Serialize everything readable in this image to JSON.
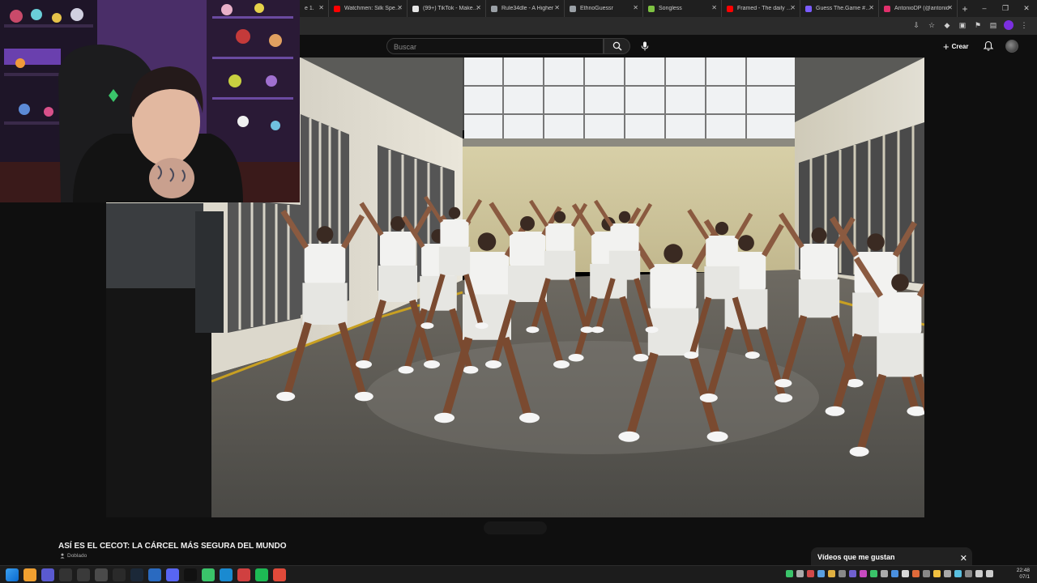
{
  "browser": {
    "tabs": [
      {
        "label": "e 1.",
        "color": "#c33"
      },
      {
        "label": "Watchmen: Silk Spectre",
        "color": "#ff0000"
      },
      {
        "label": "(99+) TikTok - Make Yo",
        "color": "#e5e5e5"
      },
      {
        "label": "Rule34dle - A Higher",
        "color": "#9aa0a6"
      },
      {
        "label": "EthnoGuessr",
        "color": "#9aa0a6"
      },
      {
        "label": "Songless",
        "color": "#7ec242"
      },
      {
        "label": "Framed - The daily mo",
        "color": "#ff0000"
      },
      {
        "label": "Guess The.Game #133",
        "color": "#7b5cff"
      },
      {
        "label": "AntonioDP (@antonio",
        "color": "#e1306c"
      }
    ],
    "window_controls": {
      "minimize": "–",
      "maximize": "❐",
      "close": "✕"
    }
  },
  "youtube": {
    "search_placeholder": "Buscar",
    "create_label": "Crear",
    "video_title": "ASÍ ES EL CECOT: LA CÁRCEL MÁS SEGURA DEL MUNDO",
    "dub_label": "Doblado",
    "liked_panel_title": "Vídeos que me gustan"
  },
  "taskbar": {
    "time": "22:48",
    "date": "07/1",
    "icons": [
      "windows-start",
      "search",
      "app-v",
      "app-bk",
      "app-dot",
      "app-ds",
      "app-obs",
      "app-steam",
      "app-s",
      "app-discord",
      "tiktok",
      "app-green",
      "app-c",
      "app-red",
      "app-sp",
      "app-chrome"
    ]
  }
}
